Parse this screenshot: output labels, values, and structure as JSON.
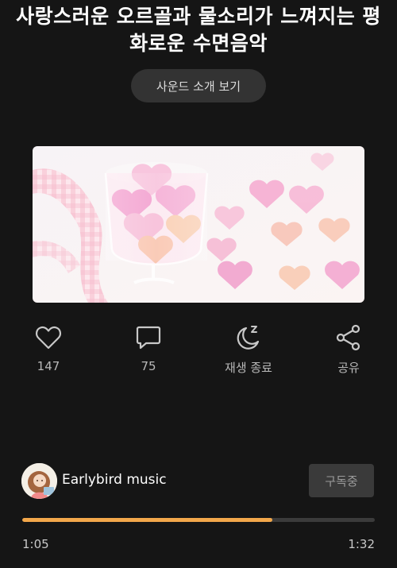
{
  "title": "사랑스러운 오르골과 물소리가 느껴지는 평화로운 수면음악",
  "intro_button": "사운드 소개 보기",
  "actions": {
    "like": {
      "icon": "heart-icon",
      "label": "147"
    },
    "comment": {
      "icon": "comment-icon",
      "label": "75"
    },
    "sleep_timer": {
      "icon": "moon-sleep-icon",
      "label": "재생 종료"
    },
    "share": {
      "icon": "share-icon",
      "label": "공유"
    }
  },
  "channel": {
    "name": "Earlybird music",
    "subscribe_label": "구독중"
  },
  "player": {
    "current_time": "1:05",
    "total_time": "1:32",
    "progress_fraction": 0.71
  },
  "colors": {
    "background": "#151515",
    "accent": "#f2a74a",
    "muted_text": "#b8b8b8"
  }
}
